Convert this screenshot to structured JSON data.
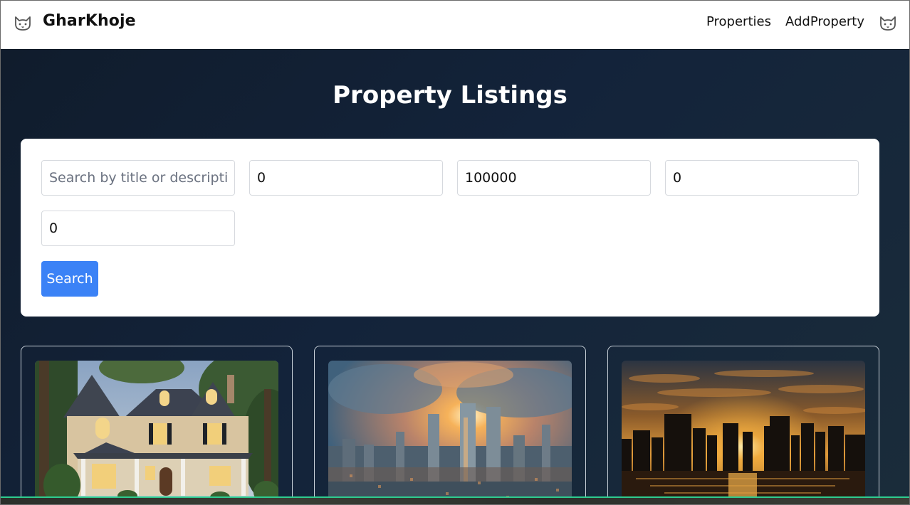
{
  "navbar": {
    "brand": "GharKhoje",
    "brand_icon": "cat-face-icon",
    "links": [
      "Properties",
      "AddProperty"
    ],
    "user_icon": "cat-face-icon"
  },
  "page": {
    "title": "Property Listings"
  },
  "search": {
    "query_placeholder": "Search by title or description",
    "query_value": "",
    "min_price": "0",
    "max_price": "100000",
    "bedrooms": "0",
    "bathrooms": "0",
    "button_label": "Search"
  },
  "listings": [
    {
      "image": "suburban-house-photo"
    },
    {
      "image": "city-skyline-sunset-photo"
    },
    {
      "image": "skyline-waterfront-sunset-photo"
    }
  ],
  "colors": {
    "primary_button": "#3b82f6",
    "background_dark": "#13233a",
    "accent_line": "#2ecc8f"
  }
}
